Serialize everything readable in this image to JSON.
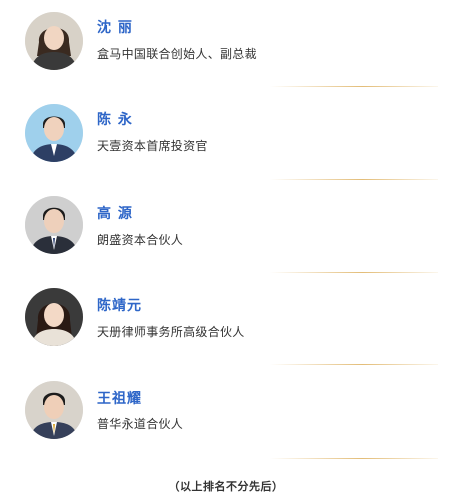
{
  "people": [
    {
      "name": "沈 丽",
      "title": "盒马中国联合创始人、副总裁",
      "avatar_icon": "portrait-woman-icon",
      "background": "#d8d2c8",
      "clothing": "#3a3a3a",
      "hair": "#3a2a20"
    },
    {
      "name": "陈 永",
      "title": "天壹资本首席投资官",
      "avatar_icon": "portrait-man-icon",
      "background": "#9fd0ec",
      "clothing": "#2d3f64",
      "hair": "#1e1e1e"
    },
    {
      "name": "高 源",
      "title": "朗盛资本合伙人",
      "avatar_icon": "portrait-man-icon",
      "background": "#cfcfcf",
      "clothing": "#2a2f3a",
      "hair": "#1b1b1b"
    },
    {
      "name": "陈靖元",
      "title": "天册律师事务所高级合伙人",
      "avatar_icon": "portrait-woman-icon",
      "background": "#3a3a3a",
      "clothing": "#e9e2d8",
      "hair": "#2a1a14"
    },
    {
      "name": "王祖耀",
      "title": "普华永道合伙人",
      "avatar_icon": "portrait-man-icon",
      "background": "#d8d3cb",
      "clothing": "#36405a",
      "hair": "#1c1c1c"
    }
  ],
  "footnote": "（以上排名不分先后）",
  "colors": {
    "name": "#2e66c8",
    "divider": "#e3bd78",
    "text": "#333333"
  }
}
